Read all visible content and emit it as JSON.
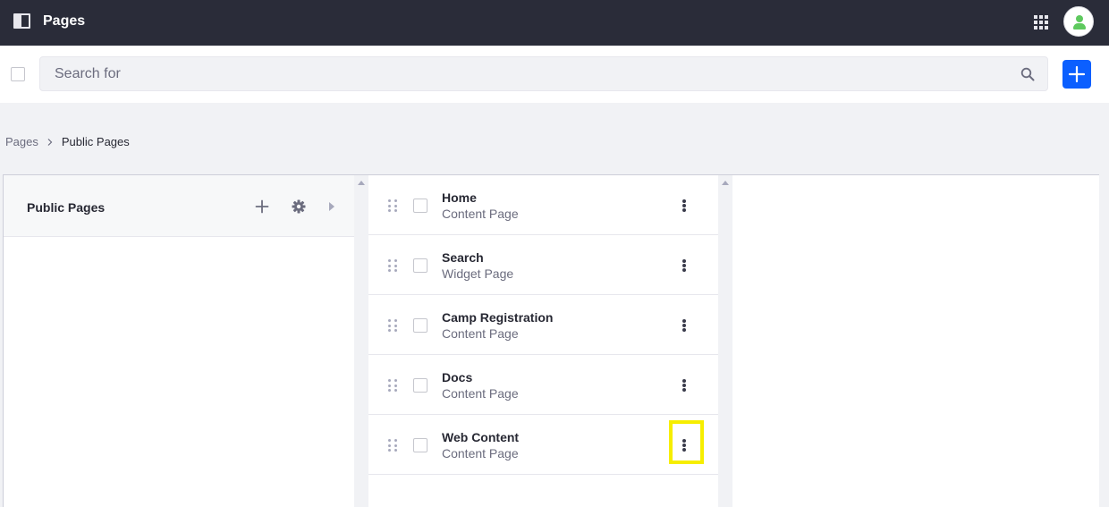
{
  "header": {
    "title": "Pages",
    "icons": {
      "sidebar_toggle": "product-menu-icon",
      "apps": "apps-grid-icon",
      "avatar": "user-avatar-icon"
    }
  },
  "toolbar": {
    "search_placeholder": "Search for",
    "icons": {
      "search": "search-icon",
      "add": "plus-icon"
    },
    "accent": "#0b5fff"
  },
  "breadcrumb": {
    "items": [
      "Pages",
      "Public Pages"
    ]
  },
  "columns": {
    "root": {
      "title": "Public Pages",
      "icons": {
        "add": "plus-icon",
        "settings": "gear-icon",
        "expand": "caret-right-icon"
      }
    },
    "pages": [
      {
        "title": "Home",
        "type": "Content Page"
      },
      {
        "title": "Search",
        "type": "Widget Page"
      },
      {
        "title": "Camp Registration",
        "type": "Content Page"
      },
      {
        "title": "Docs",
        "type": "Content Page"
      },
      {
        "title": "Web Content",
        "type": "Content Page",
        "highlighted": true
      }
    ]
  },
  "colors": {
    "topbar_bg": "#2a2c39",
    "highlight": "#f6ee00",
    "avatar": "#5ec95e"
  }
}
